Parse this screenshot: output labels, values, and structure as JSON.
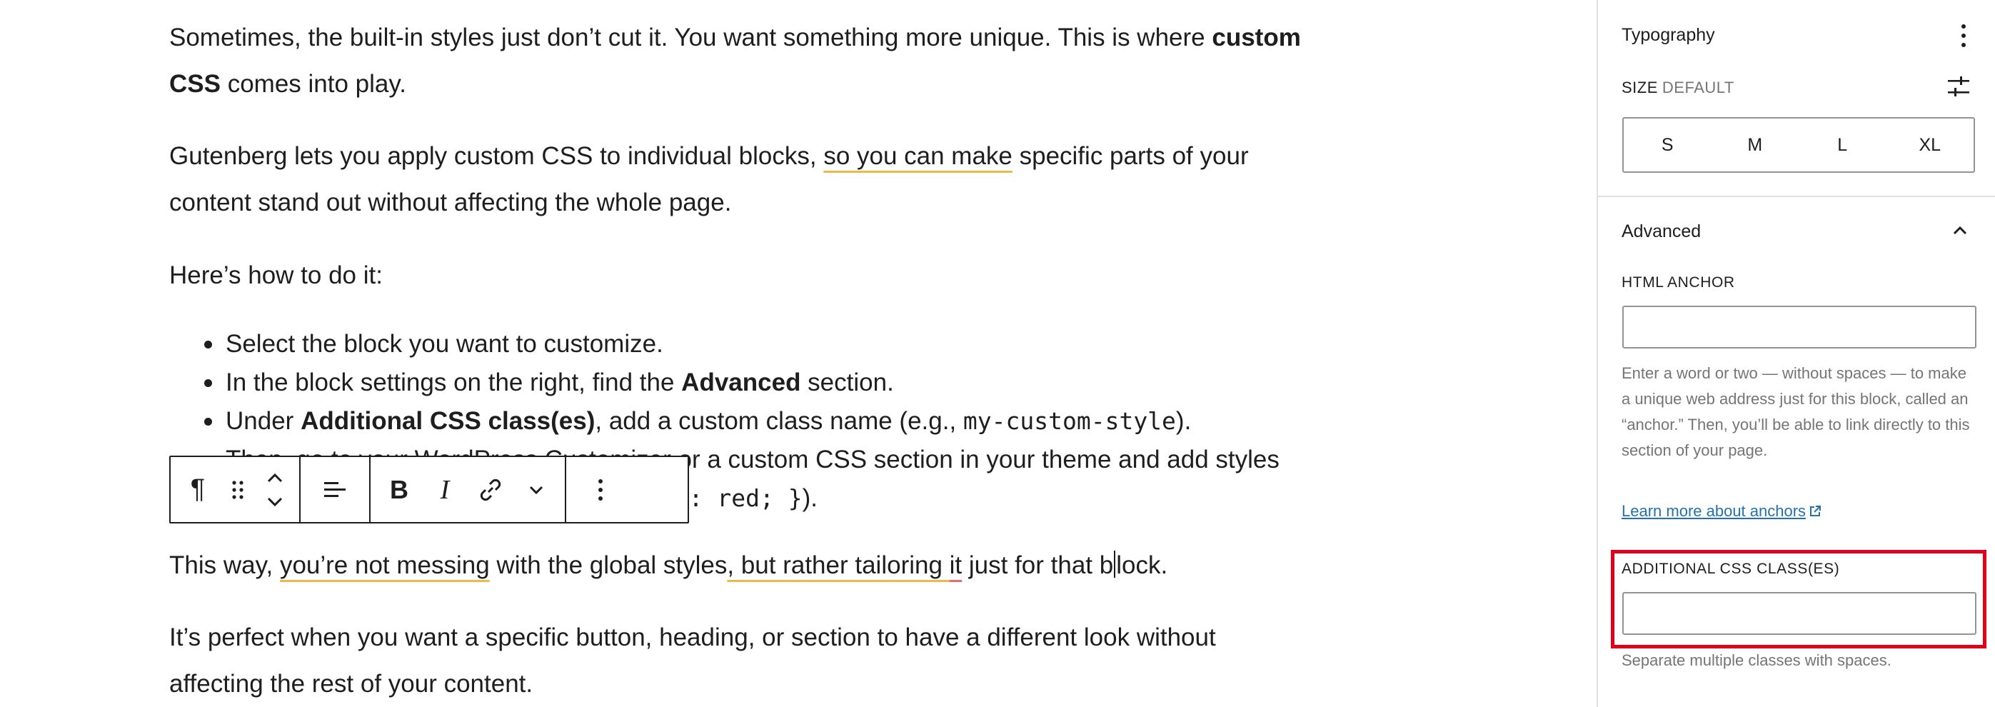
{
  "editor": {
    "p1": {
      "pre": "Sometimes, the built-in styles just don’t cut it. You want something more unique. This is where ",
      "bold": "custom",
      "line2_bold": "CSS",
      "line2_rest": " comes into play."
    },
    "p2": {
      "pre": "Gutenberg lets you apply custom CSS to individual blocks, ",
      "underlined": "so you can make",
      "post": " specific parts of your",
      "line2": "content stand out without affecting the whole page."
    },
    "p3": "Here’s how to do it:",
    "list": {
      "i1": "Select the block you want to customize.",
      "i2_pre": "In the block settings on the right, find the ",
      "i2_bold": "Advanced",
      "i2_post": " section.",
      "i3_pre": "Under ",
      "i3_bold": "Additional CSS class(es)",
      "i3_mid": ", add a custom class name (e.g., ",
      "i3_code": "my-custom-style",
      "i3_post": ").",
      "i4_visible": "or a custom CSS section in your theme and add styles",
      "i4_hidden_prefix": "Then, go to your WordPress Customizer ",
      "i4_cont_code": "le { color: red; }",
      "i4_cont_post": ")."
    },
    "p4": {
      "pre": "This way, ",
      "u1": "you’re not messing",
      "mid": " with the global styles",
      "u2a": ", but rather tailoring ",
      "u2b": "it",
      "post_a": " just for that b",
      "post_b": "lock."
    },
    "p5": {
      "line1": "It’s perfect when you want a specific button, heading, or section to have a different look without",
      "line2": "affecting the rest of your content."
    }
  },
  "toolbar": {
    "paragraph_glyph": "¶",
    "bold": "B",
    "italic": "I",
    "icons": [
      "paragraph-icon",
      "drag-handle-icon",
      "move-up-icon",
      "move-down-icon",
      "align-icon",
      "bold-icon",
      "italic-icon",
      "link-icon",
      "chevron-down-icon",
      "more-options-icon"
    ]
  },
  "sidebar": {
    "typography_title": "Typography",
    "size_label": "SIZE",
    "size_value": "DEFAULT",
    "sizes": [
      "S",
      "M",
      "L",
      "XL"
    ],
    "advanced_title": "Advanced",
    "html_anchor_label": "HTML ANCHOR",
    "html_anchor_value": "",
    "html_anchor_help": "Enter a word or two — without spaces — to make a unique web address just for this block, called an “anchor.” Then, you’ll be able to link directly to this section of your page.",
    "learn_more": "Learn more about anchors",
    "css_class_label": "ADDITIONAL CSS CLASS(ES)",
    "css_class_value": "",
    "css_class_help": "Separate multiple classes with spaces.",
    "colors": {
      "link": "#2271b1",
      "highlight": "#e1001a",
      "border": "#949494"
    }
  }
}
